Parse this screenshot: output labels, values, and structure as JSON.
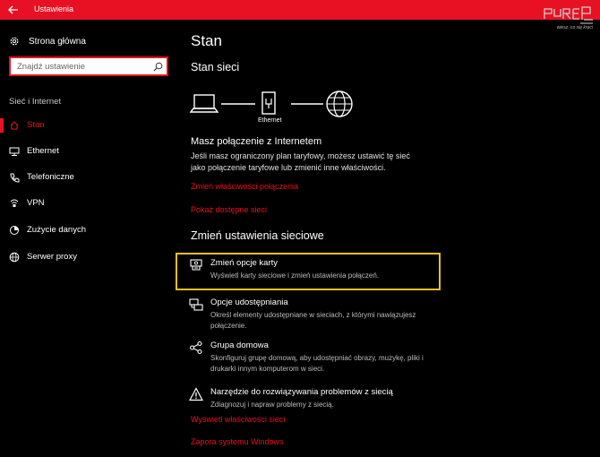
{
  "window": {
    "title": "Ustawienia"
  },
  "watermark": {
    "text": "wiesz, co się kręci"
  },
  "sidebar": {
    "home_label": "Strona główna",
    "search_placeholder": "Znajdź ustawienie",
    "section_label": "Sieć i Internet",
    "items": [
      {
        "label": "Stan",
        "icon": "home-network-icon",
        "selected": true
      },
      {
        "label": "Ethernet",
        "icon": "monitor-icon",
        "selected": false
      },
      {
        "label": "Telefoniczne",
        "icon": "phone-icon",
        "selected": false
      },
      {
        "label": "VPN",
        "icon": "vpn-icon",
        "selected": false
      },
      {
        "label": "Zużycie danych",
        "icon": "data-usage-icon",
        "selected": false
      },
      {
        "label": "Serwer proxy",
        "icon": "globe-icon",
        "selected": false
      }
    ]
  },
  "main": {
    "title": "Stan",
    "network_status_title": "Stan sieci",
    "diagram": {
      "ethernet_label": "Ethernet"
    },
    "connection_title": "Masz połączenie z Internetem",
    "connection_desc": "Jeśli masz ograniczony plan taryfowy, możesz ustawić tę sieć jako połączenie taryfowe lub zmienić inne właściwości.",
    "link_change_properties": "Zmień właściwości połączenia",
    "link_show_networks": "Pokaż dostępne sieci",
    "change_settings_title": "Zmień ustawienia sieciowe",
    "options": [
      {
        "title": "Zmień opcje karty",
        "desc": "Wyświetl karty sieciowe i zmień ustawienia połączeń.",
        "icon": "adapter-icon"
      },
      {
        "title": "Opcje udostępniania",
        "desc": "Określ elementy udostępniane w sieciach, z którymi nawiązujesz połączenie.",
        "icon": "sharing-icon"
      },
      {
        "title": "Grupa domowa",
        "desc": "Skonfiguruj grupę domową, aby udostępniać obrazy, muzykę, pliki i drukarki innym komputerom w sieci.",
        "icon": "homegroup-icon"
      },
      {
        "title": "Narzędzie do rozwiązywania problemów z siecią",
        "desc": "Zdiagnozuj i napraw problemy z siecią.",
        "icon": "warning-icon"
      }
    ],
    "link_view_properties": "Wyświetl właściwości sieci",
    "link_firewall": "Zapora systemu Windows"
  },
  "colors": {
    "accent": "#e81123",
    "highlight": "#e8c020",
    "background": "#000000"
  }
}
